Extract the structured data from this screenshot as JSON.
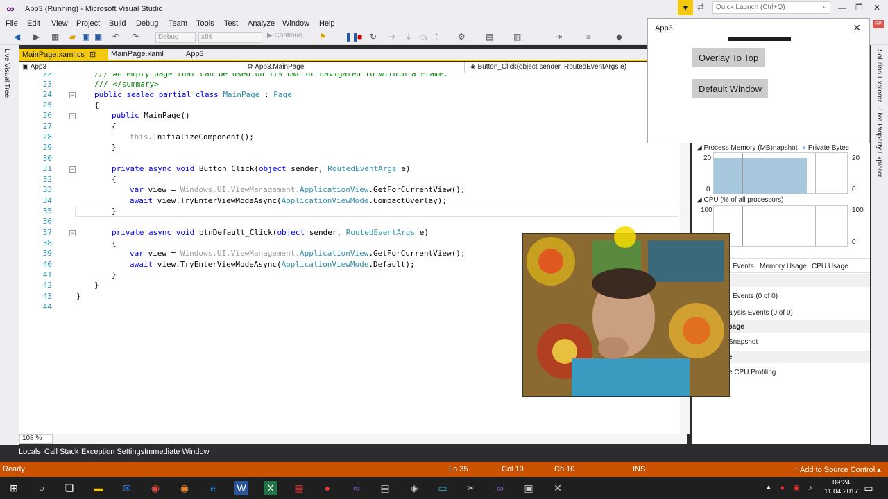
{
  "window": {
    "title": "App3 (Running) - Microsoft Visual Studio",
    "quick_launch_placeholder": "Quick Launch (Ctrl+Q)",
    "user_initials": "RP"
  },
  "menu": [
    "File",
    "Edit",
    "View",
    "Project",
    "Build",
    "Debug",
    "Team",
    "Tools",
    "Test",
    "Analyze",
    "Window",
    "Help"
  ],
  "toolbar": {
    "config": "Debug",
    "platform": "x86",
    "continue_label": "Continue"
  },
  "side_panels": {
    "left": "Live Visual Tree",
    "right_top": "Solution Explorer",
    "right_bottom": "Live Property Explorer"
  },
  "tabs": [
    {
      "label": "MainPage.xaml.cs"
    },
    {
      "label": "MainPage.xaml"
    },
    {
      "label": "App3"
    }
  ],
  "navbar": {
    "project": "App3",
    "class": "App3.MainPage",
    "member": "Button_Click(object sender, RoutedEventArgs e)"
  },
  "editor": {
    "zoom": "108 %"
  },
  "bottom_tabs": [
    "Locals",
    "Call Stack",
    "Exception Settings",
    "Immediate Window"
  ],
  "status": {
    "state": "Ready",
    "line": "Ln 35",
    "col": "Col 10",
    "ch": "Ch 10",
    "mode": "INS",
    "source_control": "Add to Source Control"
  },
  "clock": {
    "time": "09:24",
    "date": "11.04.2017"
  },
  "app3": {
    "title": "App3",
    "btn_overlay": "Overlay To Top",
    "btn_default": "Default Window"
  },
  "diagnostics": {
    "memory_title": "Process Memory (MB)",
    "snapshot_legend": "napshot",
    "private_bytes_legend": "Private Bytes",
    "mem_max": "20",
    "mem_min": "0",
    "cpu_title": "CPU (% of all processors)",
    "cpu_max": "100",
    "cpu_min": "0",
    "tabs": [
      "Events",
      "Memory Usage",
      "CPU Usage"
    ],
    "rows": [
      "Events (0 of 0)",
      "alysis Events (0 of 0)",
      "sage",
      "Snapshot",
      "e",
      "e CPU Profiling"
    ]
  }
}
